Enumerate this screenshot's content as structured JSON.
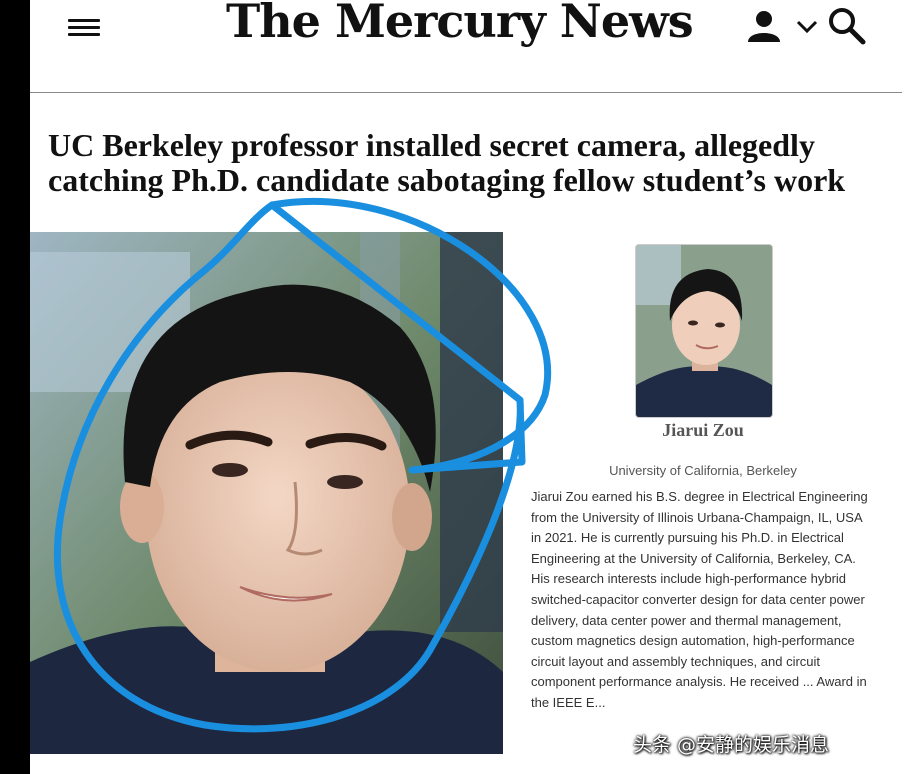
{
  "header": {
    "masthead": "The Mercury News",
    "menu_icon": "hamburger-menu-icon",
    "account_icon": "user-icon",
    "dropdown_icon": "chevron-down-icon",
    "search_icon": "search-icon"
  },
  "article": {
    "headline": "UC Berkeley professor installed secret camera, allegedly catching Ph.D. candidate sabotaging fellow student’s work"
  },
  "profile": {
    "name": "Jiarui Zou",
    "affiliation": "University of California, Berkeley",
    "bio": "Jiarui Zou earned his B.S. degree in Electrical Engineering from the University of Illinois Urbana-Champaign, IL, USA in 2021. He is currently pursuing his Ph.D. in Electrical Engineering at the University of California, Berkeley, CA. His research interests include high-performance hybrid switched-capacitor converter design for data center power delivery, data center power and thermal management, custom magnetics design automation, high-performance circuit layout and assembly techniques, and circuit component performance analysis. He received ... Award in the IEEE E..."
  },
  "watermark": "头条 @安静的娱乐消息",
  "colors": {
    "annotation_circle": "#1a8fe0",
    "page_background": "#ffffff",
    "left_border": "#000000"
  }
}
